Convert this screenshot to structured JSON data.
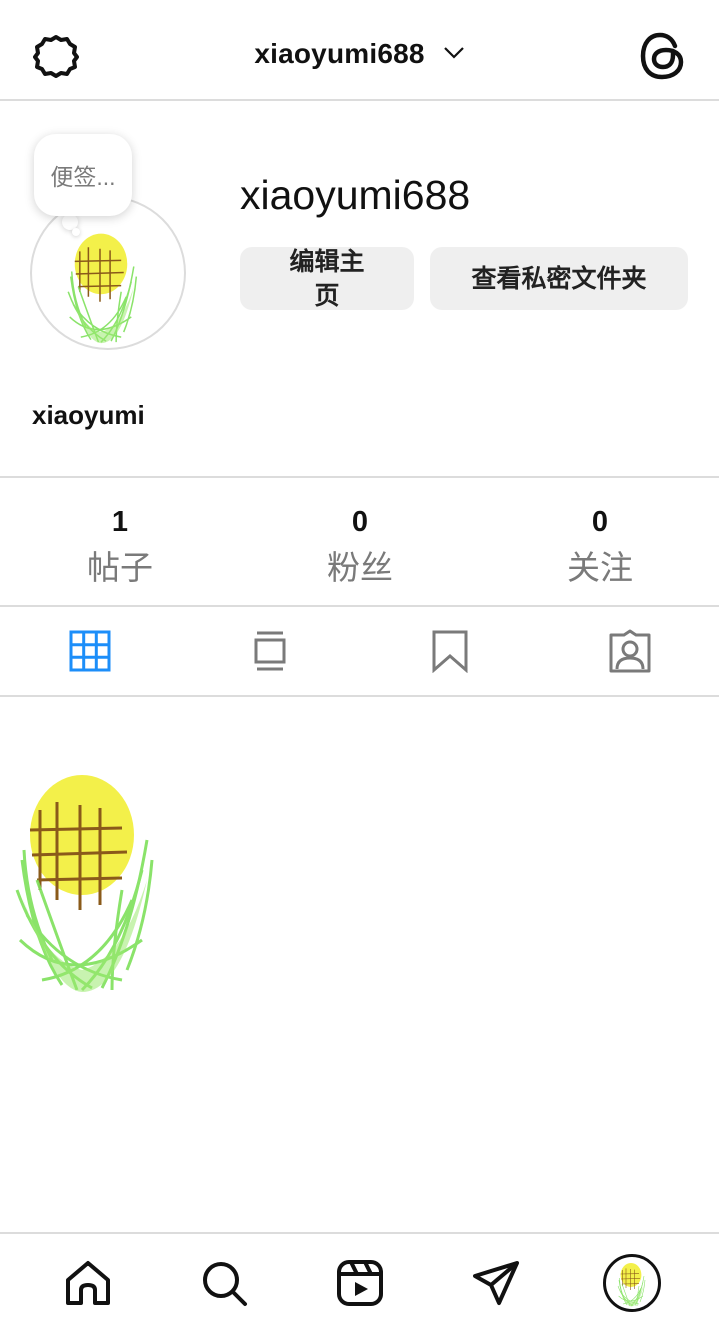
{
  "header": {
    "settings_icon": "settings-gear-icon",
    "username": "xiaoyumi688",
    "dropdown_icon": "chevron-down-icon",
    "threads_icon": "threads-icon"
  },
  "profile": {
    "note_text": "便签...",
    "username": "xiaoyumi688",
    "display_name": "xiaoyumi",
    "edit_button": "编辑主页",
    "private_folder_button": "查看私密文件夹"
  },
  "stats": [
    {
      "value": "1",
      "label": "帖子"
    },
    {
      "value": "0",
      "label": "粉丝"
    },
    {
      "value": "0",
      "label": "关注"
    }
  ],
  "tabs": [
    {
      "icon": "grid-icon",
      "active": true
    },
    {
      "icon": "feed-icon",
      "active": false
    },
    {
      "icon": "bookmark-icon",
      "active": false
    },
    {
      "icon": "tagged-icon",
      "active": false
    }
  ],
  "bottom_nav": [
    {
      "icon": "home-icon"
    },
    {
      "icon": "search-icon"
    },
    {
      "icon": "reels-icon"
    },
    {
      "icon": "direct-message-icon"
    },
    {
      "icon": "profile-avatar-icon"
    }
  ],
  "colors": {
    "active_tab": "#1c8ef9",
    "inactive_icon": "#7a7a7a",
    "button_bg": "#efefef",
    "divider": "#dcdcdc"
  }
}
